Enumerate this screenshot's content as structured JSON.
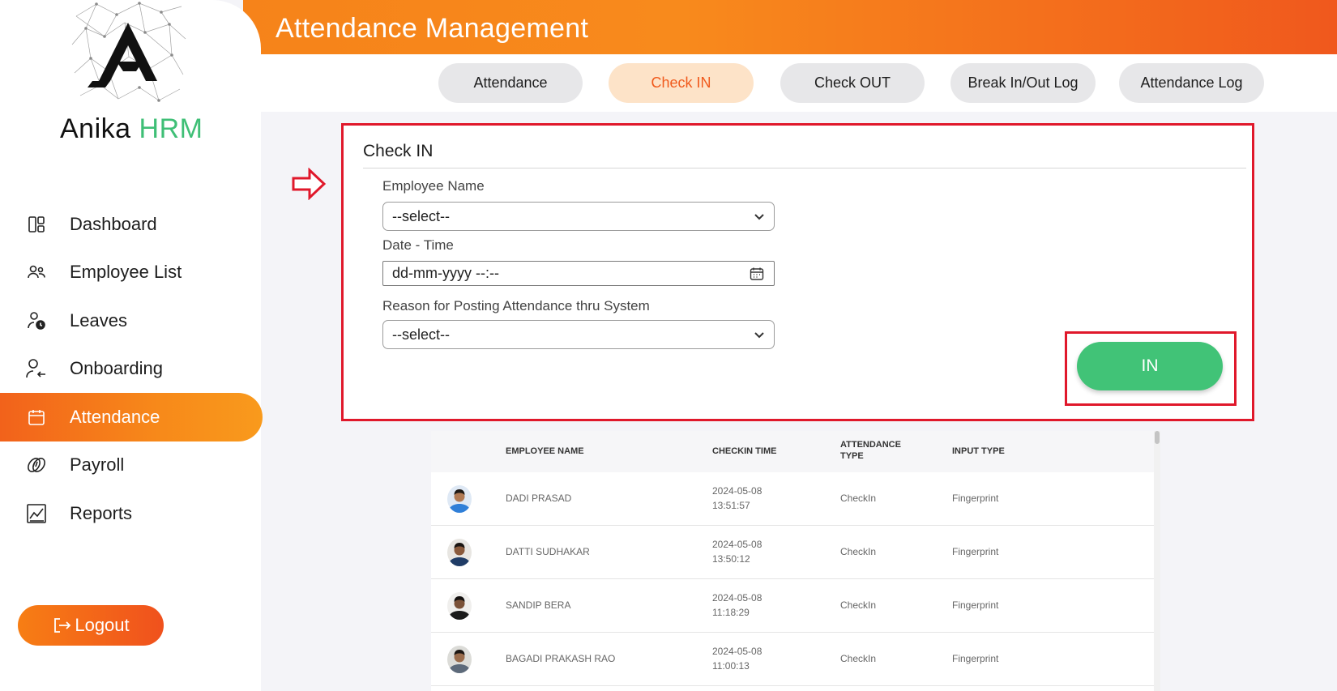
{
  "header": {
    "title": "Attendance Management"
  },
  "brand": {
    "name_part1": "Anika",
    "name_part2": "HRM"
  },
  "sidebar": {
    "items": [
      {
        "label": "Dashboard",
        "icon": "dashboard-icon"
      },
      {
        "label": "Employee List",
        "icon": "users-icon"
      },
      {
        "label": "Leaves",
        "icon": "user-clock-icon"
      },
      {
        "label": "Onboarding",
        "icon": "user-arrow-icon"
      },
      {
        "label": "Attendance",
        "icon": "calendar-icon",
        "active": true
      },
      {
        "label": "Payroll",
        "icon": "coins-icon"
      },
      {
        "label": "Reports",
        "icon": "chart-icon"
      }
    ],
    "logout_label": "Logout"
  },
  "tabs": [
    {
      "label": "Attendance"
    },
    {
      "label": "Check IN",
      "active": true
    },
    {
      "label": "Check OUT"
    },
    {
      "label": "Break In/Out Log"
    },
    {
      "label": "Attendance Log"
    }
  ],
  "checkin": {
    "title": "Check IN",
    "employee_label": "Employee Name",
    "employee_value": "--select--",
    "datetime_label": "Date - Time",
    "datetime_value": "dd-mm-yyyy --:--",
    "reason_label": "Reason for Posting Attendance thru System",
    "reason_value": "--select--",
    "in_button": "IN"
  },
  "table": {
    "headers": {
      "name": "EMPLOYEE NAME",
      "checkin": "CHECKIN TIME",
      "type_line1": "ATTENDANCE",
      "type_line2": "TYPE",
      "input": "INPUT TYPE"
    },
    "rows": [
      {
        "name": "DADI PRASAD",
        "date": "2024-05-08",
        "time": "13:51:57",
        "type": "CheckIn",
        "input": "Fingerprint"
      },
      {
        "name": "DATTI SUDHAKAR",
        "date": "2024-05-08",
        "time": "13:50:12",
        "type": "CheckIn",
        "input": "Fingerprint"
      },
      {
        "name": "SANDIP BERA",
        "date": "2024-05-08",
        "time": "11:18:29",
        "type": "CheckIn",
        "input": "Fingerprint"
      },
      {
        "name": "BAGADI PRAKASH RAO",
        "date": "2024-05-08",
        "time": "11:00:13",
        "type": "CheckIn",
        "input": "Fingerprint"
      }
    ]
  },
  "colors": {
    "accent": "#f7891a",
    "active_tab_text": "#f05a1c",
    "in_button": "#41c377",
    "highlight_box": "#e0182b",
    "brand_green": "#3fbf76"
  }
}
